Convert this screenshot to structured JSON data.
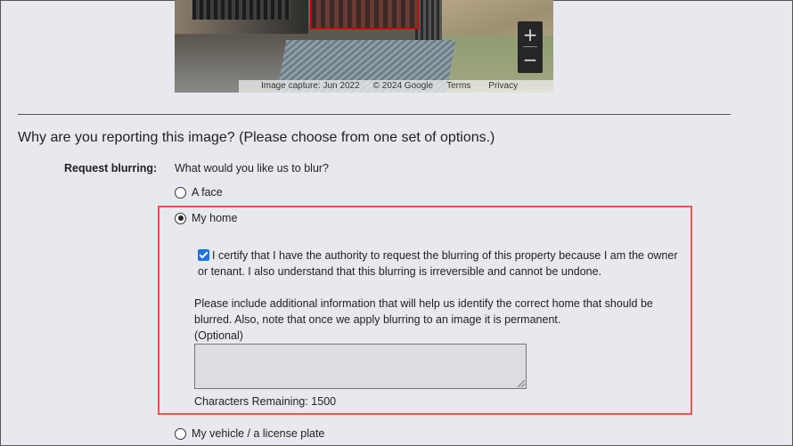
{
  "map": {
    "zoom_in_label": "+",
    "zoom_out_label": "−",
    "image_capture": "Image capture: Jun 2022",
    "copyright": "© 2024 Google",
    "terms": "Terms",
    "privacy": "Privacy"
  },
  "form": {
    "question": "Why are you reporting this image?  (Please choose from one set of options.)",
    "request_label": "Request blurring:",
    "request_prompt": "What would you like us to blur?",
    "options": [
      {
        "label": "A face",
        "selected": false
      },
      {
        "label": "My home",
        "selected": true
      },
      {
        "label": "My vehicle / a license plate",
        "selected": false
      }
    ],
    "certify_checked": true,
    "certify_text": "I certify that I have the authority to request the blurring of this property because I am the owner or tenant. I also understand that this blurring is irreversible and cannot be undone.",
    "info_text": "Please include additional information that will help us identify the correct home that should be blurred. Also, note that once we apply blurring to an image it is permanent.",
    "optional_label": "(Optional)",
    "additional_info_value": "",
    "chars_remaining": "Characters Remaining: 1500"
  },
  "colors": {
    "highlight_border": "#e8554f",
    "background": "#e8e9ee",
    "checkbox": "#1a73e8"
  }
}
